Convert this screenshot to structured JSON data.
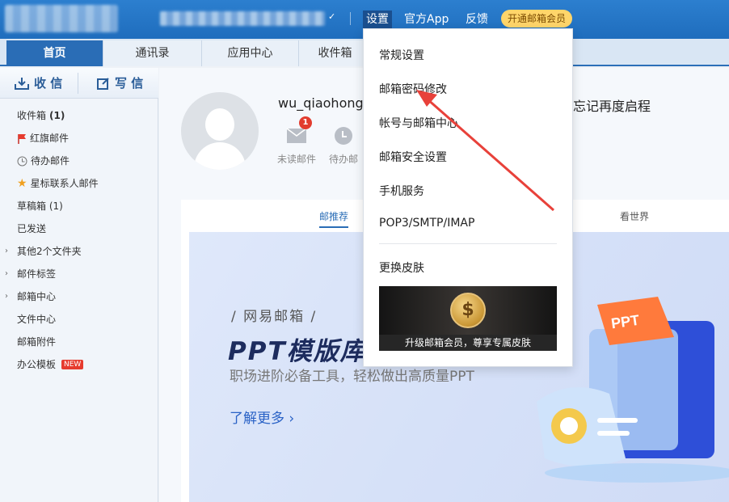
{
  "header": {
    "links": {
      "settings": "设置",
      "app": "官方App",
      "feedback": "反馈"
    },
    "vip_button": "开通邮箱会员"
  },
  "tabs": [
    "首页",
    "通讯录",
    "应用中心",
    "收件箱"
  ],
  "sidebar": {
    "receive": "收 信",
    "compose": "写 信",
    "folders": {
      "inbox": "收件箱",
      "inbox_count": "(1)",
      "flagged": "红旗邮件",
      "todo": "待办邮件",
      "starred": "星标联系人邮件",
      "drafts": "草稿箱 (1)",
      "sent": "已发送",
      "other": "其他2个文件夹",
      "tags": "邮件标签",
      "mail_center": "邮箱中心",
      "file_center": "文件中心",
      "attachments": "邮箱附件",
      "office": "办公模板",
      "new_badge": "NEW"
    }
  },
  "main": {
    "username": "wu_qiaohong",
    "greeting": "忘记再度启程",
    "stats": {
      "unread": "未读邮件",
      "unread_count": "1",
      "todo": "待办邮"
    },
    "content_tabs": {
      "recommend": "邮推荐",
      "world": "看世界"
    },
    "banner": {
      "brand": "/ 网易邮箱 /",
      "title": "PPT模版库",
      "subtitle": "职场进阶必备工具，轻松做出高质量PPT",
      "link": "了解更多 ›",
      "ppt_badge": "PPT"
    }
  },
  "settings_menu": {
    "items": [
      "常规设置",
      "邮箱密码修改",
      "帐号与邮箱中心",
      "邮箱安全设置",
      "手机服务",
      "POP3/SMTP/IMAP",
      "更换皮肤"
    ],
    "promo_caption": "升级邮箱会员，尊享专属皮肤"
  },
  "colors": {
    "brand_blue": "#2a6db6",
    "annotation_arrow": "#e8413a",
    "vip": "#ffd56a"
  }
}
